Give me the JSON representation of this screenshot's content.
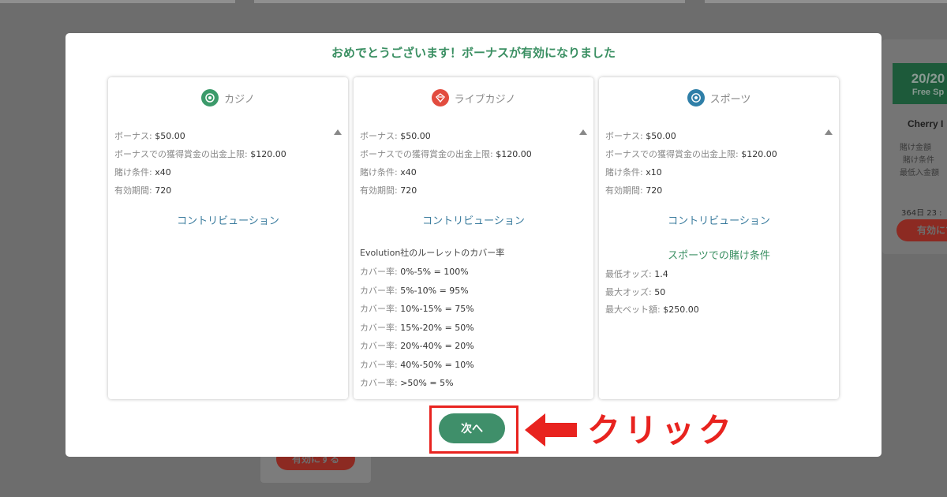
{
  "background": {
    "free_spins_count": "20/20",
    "free_spins_label": "Free Sp",
    "game_name": "Cherry I",
    "lines": [
      "賭け金額",
      "賭け条件",
      "最低入金額"
    ],
    "days": "364日  23 :",
    "activate_right": "有効にす",
    "activate_bottom": "有効にする"
  },
  "modal": {
    "title": "おめでとうございます！ボーナスが有効になりました",
    "next_button": "次へ"
  },
  "cards": [
    {
      "label": "カジノ",
      "icon": "casino-chip-icon",
      "color": "#3b9a6a",
      "details": [
        {
          "label": "ボーナス: ",
          "value": "$50.00"
        },
        {
          "label": "ボーナスでの獲得賞金の出金上限: ",
          "value": "$120.00"
        },
        {
          "label": "賭け条件: ",
          "value": "x40"
        },
        {
          "label": "有効期間: ",
          "value": "720"
        }
      ],
      "contribution_link": "コントリビューション"
    },
    {
      "label": "ライブカジノ",
      "icon": "live-casino-icon",
      "color": "#e24c3f",
      "details": [
        {
          "label": "ボーナス: ",
          "value": "$50.00"
        },
        {
          "label": "ボーナスでの獲得賞金の出金上限: ",
          "value": "$120.00"
        },
        {
          "label": "賭け条件: ",
          "value": "x40"
        },
        {
          "label": "有効期間: ",
          "value": "720"
        }
      ],
      "contribution_link": "コントリビューション",
      "contribution_title": "Evolution社のルーレットのカバー率",
      "contribution_rows": [
        {
          "label": "カバー率: ",
          "value": "0%-5% = 100%"
        },
        {
          "label": "カバー率: ",
          "value": "5%-10% = 95%"
        },
        {
          "label": "カバー率: ",
          "value": "10%-15% = 75%"
        },
        {
          "label": "カバー率: ",
          "value": "15%-20% = 50%"
        },
        {
          "label": "カバー率: ",
          "value": "20%-40% = 20%"
        },
        {
          "label": "カバー率: ",
          "value": "40%-50% = 10%"
        },
        {
          "label": "カバー率: ",
          "value": ">50% = 5%"
        }
      ]
    },
    {
      "label": "スポーツ",
      "icon": "soccer-ball-icon",
      "color": "#2f7fa8",
      "details": [
        {
          "label": "ボーナス: ",
          "value": "$50.00"
        },
        {
          "label": "ボーナスでの獲得賞金の出金上限: ",
          "value": "$120.00"
        },
        {
          "label": "賭け条件: ",
          "value": "x10"
        },
        {
          "label": "有効期間: ",
          "value": "720"
        }
      ],
      "contribution_link": "コントリビューション",
      "sports_title": "スポーツでの賭け条件",
      "sports_rows": [
        {
          "label": "最低オッズ: ",
          "value": "1.4"
        },
        {
          "label": "最大オッズ: ",
          "value": "50"
        },
        {
          "label": "最大ベット額: ",
          "value": "$250.00"
        }
      ]
    }
  ],
  "annotation": {
    "click_text": "クリック",
    "color": "#e8231f"
  }
}
